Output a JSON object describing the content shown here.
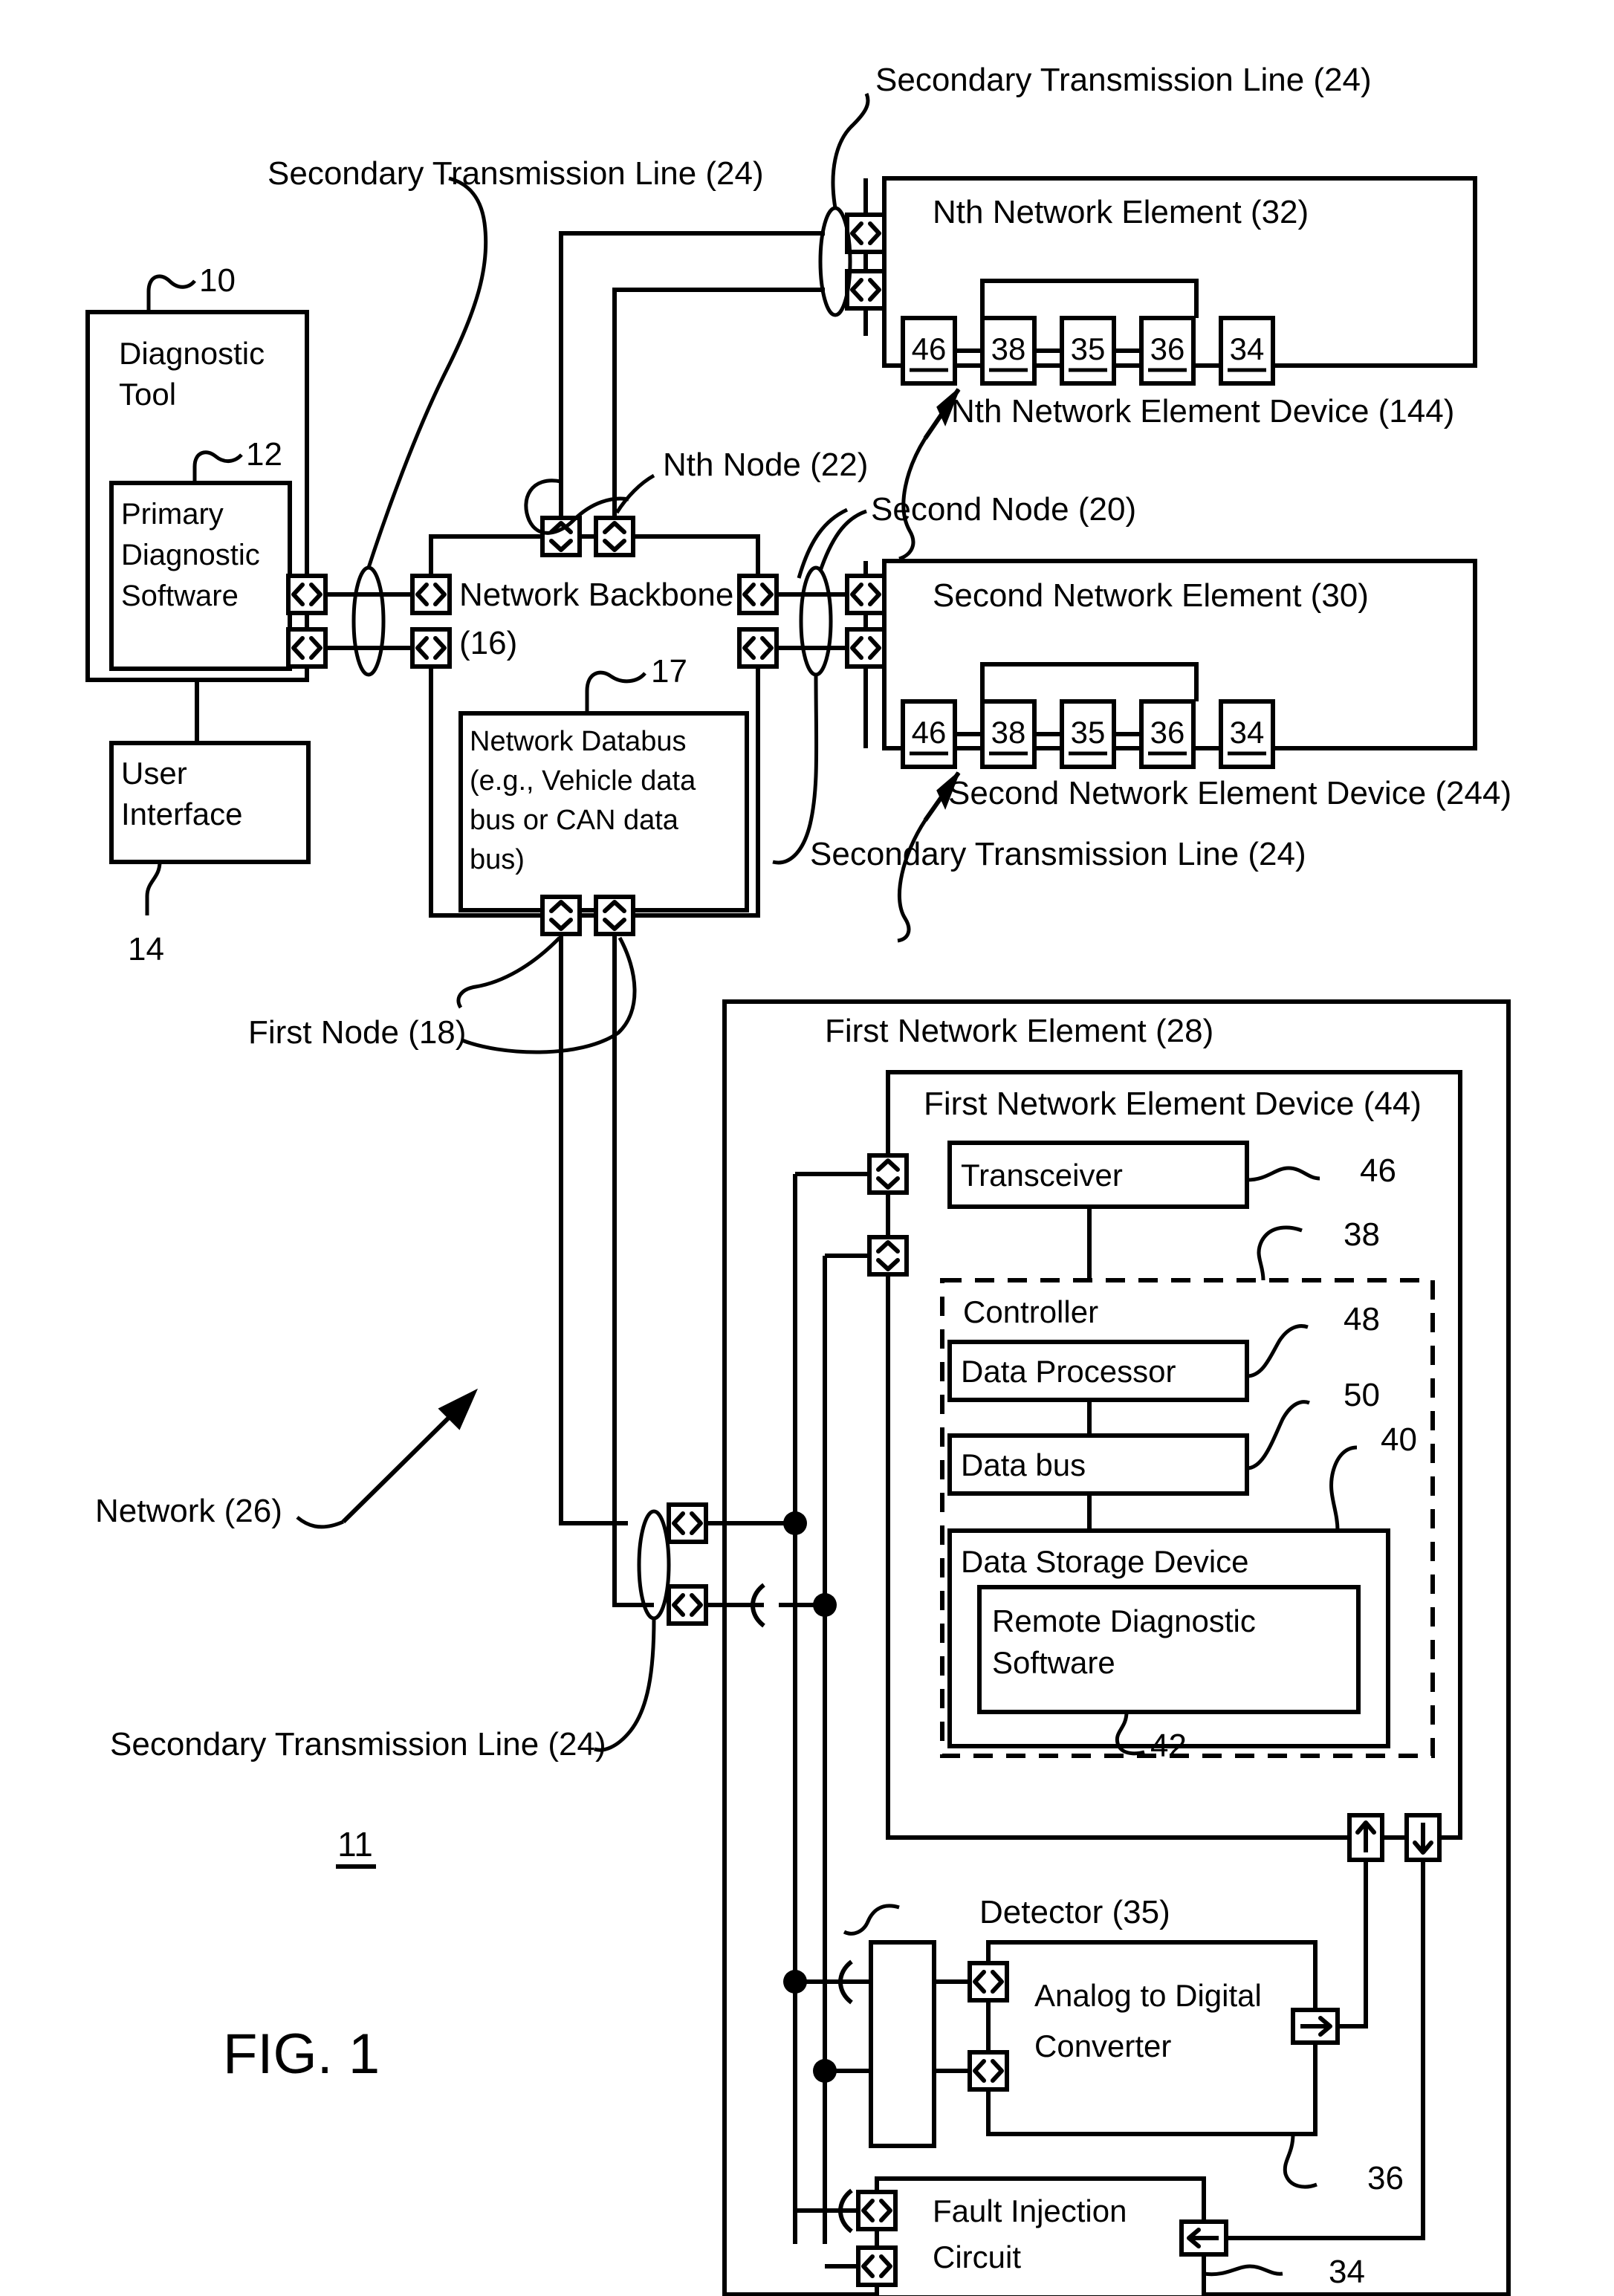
{
  "figure": {
    "caption": "FIG. 1",
    "system_ref": "11"
  },
  "blocks": {
    "diagnostic_tool": "Diagnostic\nTool",
    "diagnostic_tool_line1": "Diagnostic",
    "diagnostic_tool_line2": "Tool",
    "primary_diagnostic_software_line1": "Primary",
    "primary_diagnostic_software_line2": "Diagnostic",
    "primary_diagnostic_software_line3": "Software",
    "user_interface_line1": "User",
    "user_interface_line2": "Interface",
    "network_backbone_line1": "Network Backbone",
    "network_backbone_line2": "(16)",
    "network_databus_line1": "Network Databus",
    "network_databus_line2": "(e.g., Vehicle data",
    "network_databus_line3": "bus or CAN data",
    "network_databus_line4": "bus)",
    "nth_network_element": "Nth Network Element (32)",
    "second_network_element": "Second Network Element (30)",
    "first_network_element": "First Network Element (28)",
    "first_network_element_device": "First Network Element Device (44)",
    "transceiver": "Transceiver",
    "controller": "Controller",
    "data_processor": "Data Processor",
    "data_bus": "Data bus",
    "data_storage_device": "Data Storage Device",
    "remote_diagnostic_software_line1": "Remote Diagnostic",
    "remote_diagnostic_software_line2": "Software",
    "analog_to_digital_line1": "Analog to Digital",
    "analog_to_digital_line2": "Converter",
    "fault_injection_line1": "Fault Injection",
    "fault_injection_line2": "Circuit"
  },
  "callouts": {
    "ref_10": "10",
    "ref_12": "12",
    "ref_14": "14",
    "ref_17": "17",
    "ref_38": "38",
    "ref_40": "40",
    "ref_42": "42",
    "ref_46": "46",
    "ref_48": "48",
    "ref_50": "50",
    "ref_34": "34",
    "ref_36": "36"
  },
  "leader_labels": {
    "secondary_tx_line_top_left": "Secondary Transmission Line (24)",
    "secondary_tx_line_top_right": "Secondary Transmission Line (24)",
    "secondary_tx_line_mid_right": "Secondary Transmission Line (24)",
    "secondary_tx_line_bottom_left": "Secondary Transmission Line (24)",
    "nth_node": "Nth Node (22)",
    "second_node": "Second Node (20)",
    "first_node": "First Node (18)",
    "nth_network_element_device": "Nth Network Element Device (144)",
    "second_network_element_device": "Second Network Element Device (244)",
    "network": "Network (26)",
    "detector": "Detector (35)"
  },
  "device_chain": {
    "boxes": [
      "46",
      "38",
      "35",
      "36",
      "34"
    ]
  },
  "colors": {
    "stroke": "#000000",
    "background": "#ffffff"
  }
}
